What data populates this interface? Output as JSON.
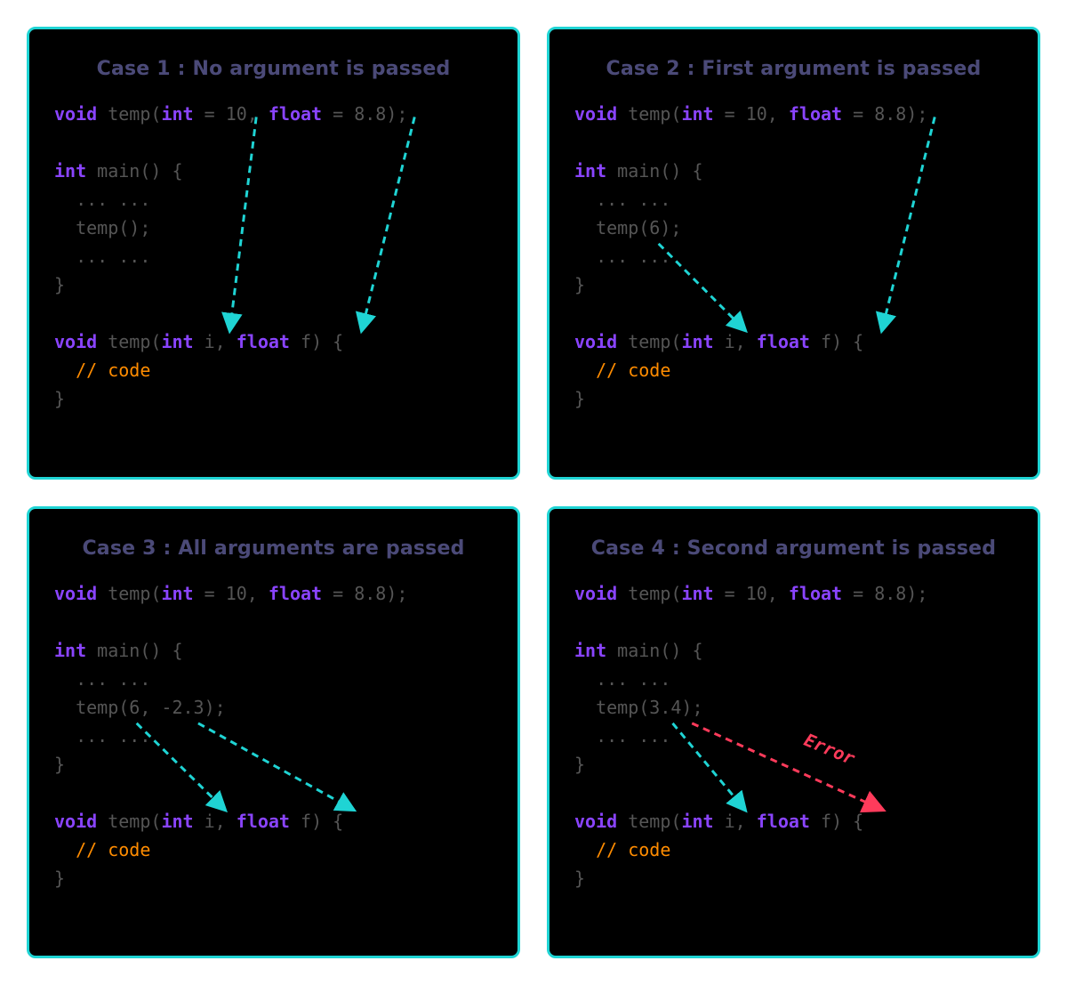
{
  "panels": {
    "p1": {
      "title": "Case 1 : No argument is passed",
      "kw_void": "void",
      "kw_int": "int",
      "kw_float": "float",
      "decl_val1": "10",
      "decl_val2": "8.8",
      "func_name": "temp",
      "main_name": "main",
      "call": "temp();",
      "ellipsis": "... ...",
      "param_i": "i",
      "param_f": "f",
      "comment": "// code"
    },
    "p2": {
      "title": "Case 2 : First argument is passed",
      "kw_void": "void",
      "kw_int": "int",
      "kw_float": "float",
      "decl_val1": "10",
      "decl_val2": "8.8",
      "func_name": "temp",
      "main_name": "main",
      "call": "temp(6);",
      "ellipsis": "... ...",
      "param_i": "i",
      "param_f": "f",
      "comment": "// code"
    },
    "p3": {
      "title": "Case 3 : All arguments are passed",
      "kw_void": "void",
      "kw_int": "int",
      "kw_float": "float",
      "decl_val1": "10",
      "decl_val2": "8.8",
      "func_name": "temp",
      "main_name": "main",
      "call": "temp(6, -2.3);",
      "ellipsis": "... ...",
      "param_i": "i",
      "param_f": "f",
      "comment": "// code"
    },
    "p4": {
      "title": "Case 4 : Second argument is passed",
      "kw_void": "void",
      "kw_int": "int",
      "kw_float": "float",
      "decl_val1": "10",
      "decl_val2": "8.8",
      "func_name": "temp",
      "main_name": "main",
      "call": "temp(3.4);",
      "ellipsis": "... ...",
      "param_i": "i",
      "param_f": "f",
      "comment": "// code",
      "error_label": "Error"
    }
  },
  "colors": {
    "accent": "#1fd4d4",
    "arrow": "#1fd4d4",
    "error": "#ff3b5b",
    "keyword": "#8a44ff",
    "comment": "#ff8c00",
    "title": "#4b4a78",
    "bg": "#000000"
  }
}
